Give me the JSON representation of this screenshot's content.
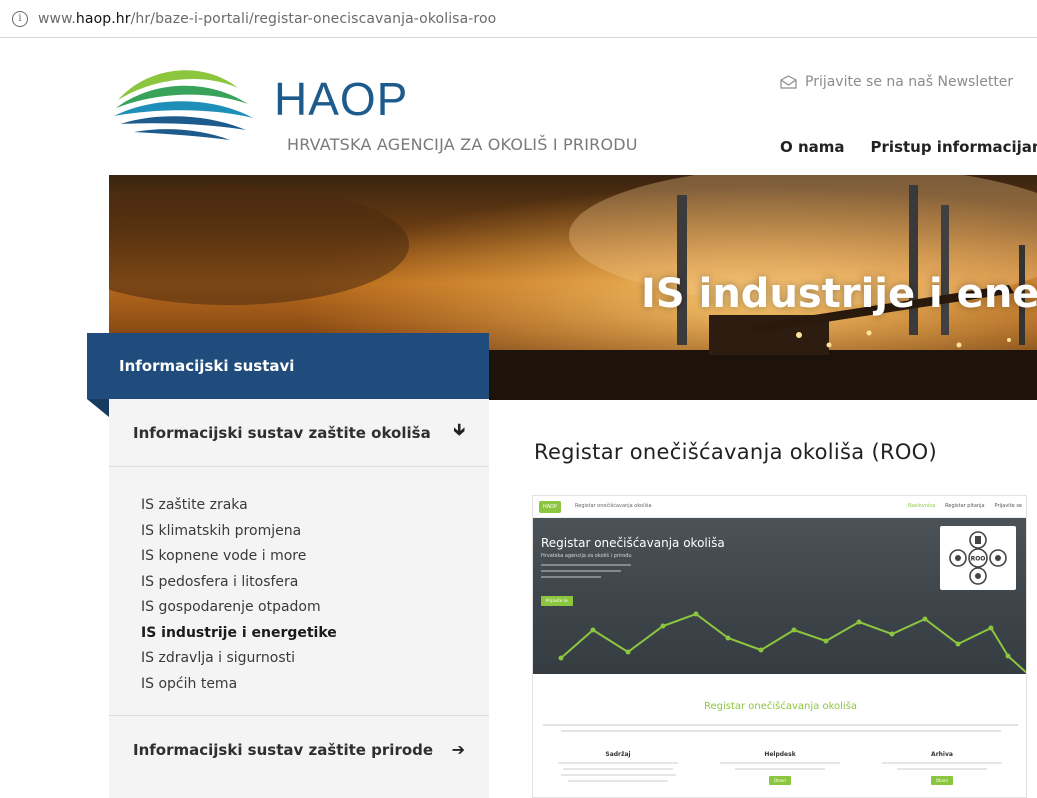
{
  "browser": {
    "url_prefix": "www.",
    "url_domain": "haop.hr",
    "url_path": "/hr/baze-i-portali/registar-oneciscavanja-okolisa-roo",
    "info_icon": "info-icon"
  },
  "header": {
    "brand": "HAOP",
    "tagline": "HRVATSKA AGENCIJA ZA OKOLIŠ I PRIRODU",
    "newsletter": "Prijavite se na naš Newsletter",
    "nav": [
      "O nama",
      "Pristup informacijam"
    ]
  },
  "banner": {
    "title": "IS industrije i energet"
  },
  "sidebar": {
    "heading": "Informacijski sustavi",
    "section1": "Informacijski sustav zaštite okoliša",
    "section1_icon": "arrow-down-icon",
    "items": [
      "IS zaštite zraka",
      "IS klimatskih promjena",
      "IS kopnene vode i more",
      "IS pedosfera i litosfera",
      "IS gospodarenje otpadom",
      "IS industrije i energetike",
      "IS zdravlja i sigurnosti",
      "IS općih tema"
    ],
    "active_index": 5,
    "section2": "Informacijski sustav zaštite prirode",
    "section2_icon": "arrow-right-icon"
  },
  "main": {
    "title": "Registar onečišćavanja okoliša (ROO)"
  },
  "preview": {
    "logo": "HAOP",
    "nav_title": "Registar onečišćavanja okoliša",
    "nav_links": [
      "Naslovnica",
      "Registar pitanja",
      "Prijavite se"
    ],
    "hero_title": "Registar onečišćavanja okoliša",
    "hero_sub": "Hrvatska agencija za okoliš i prirodu",
    "hero_button": "Prijavite se",
    "roo_label": "ROO",
    "body_title": "Registar onečišćavanja okoliša",
    "columns": [
      {
        "title": "Sadržaj",
        "button": ""
      },
      {
        "title": "Helpdesk",
        "button": "Otvori"
      },
      {
        "title": "Arhiva",
        "button": "Otvori"
      }
    ],
    "accent": "#8cc63f"
  },
  "colors": {
    "brand_blue": "#1d5b8c",
    "sidebar_head": "#1f4c7c",
    "sidebar_bg": "#f4f4f4"
  }
}
